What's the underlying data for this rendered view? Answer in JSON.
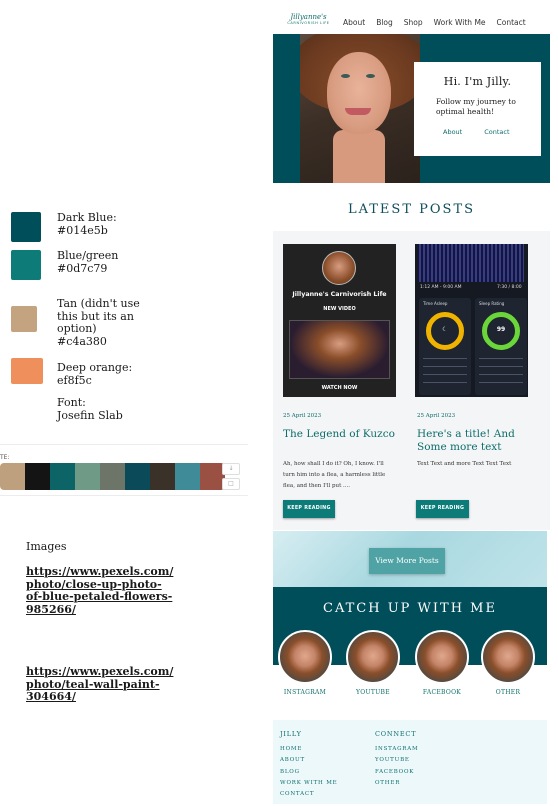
{
  "notes": {
    "swatches": [
      {
        "label": "Dark Blue:",
        "value": "#014e5b",
        "color": "#014e5b"
      },
      {
        "label": "Blue/green",
        "value": "#0d7c79",
        "color": "#0d7c79"
      },
      {
        "label": "Tan (didn't use this but its an option)",
        "value": "#c4a380",
        "color": "#c4a380"
      },
      {
        "label": "Deep orange:",
        "value": "ef8f5c",
        "color": "#ef8f5c"
      }
    ],
    "font_label": "Font:",
    "font_value": "Josefin Slab",
    "palette_label": "TE:",
    "palette_colors": [
      "#bfa07e",
      "#141414",
      "#0d6467",
      "#6f9a86",
      "#6c7567",
      "#0b4a59",
      "#3a3228",
      "#3f8b97",
      "#9a5043"
    ],
    "images_title": "Images",
    "image_links": [
      "https://www.pexels.com/photo/close-up-photo-of-blue-petaled-flowers-985266/",
      "https://www.pexels.com/photo/teal-wall-paint-304664/"
    ]
  },
  "site": {
    "logo_script": "Jillyanne's",
    "logo_sub": "CARNIVORISH LIFE",
    "nav": [
      "About",
      "Blog",
      "Shop",
      "Work With Me",
      "Contact"
    ],
    "hero": {
      "title": "Hi. I'm Jilly.",
      "subtitle": "Follow my journey to optimal health!",
      "links": [
        "About",
        "Contact"
      ]
    },
    "latest_heading": "LATEST POSTS",
    "posts": [
      {
        "date": "25 April 2023",
        "title": "The Legend of Kuzco",
        "excerpt": "Ah, how shall I do it? Oh, I know. I'll turn him into a flea, a harmless little flea, and then I'll put ....",
        "button": "KEEP READING",
        "thumb_title": "Jillyanne's Carnivorish Life",
        "thumb_new": "NEW VIDEO",
        "thumb_watch": "WATCH NOW"
      },
      {
        "date": "25 April 2023",
        "title": "Here's a title! And Some more text",
        "excerpt": "Text Text and more Text Text Text",
        "button": "KEEP READING",
        "thumb_time_left": "1:12 AM - 9:00 AM",
        "thumb_time_right": "7:30 / 8:00",
        "thumb_panel_left": "Time Asleep",
        "thumb_panel_right": "Sleep Rating",
        "thumb_score": "99"
      }
    ],
    "more_button": "View More Posts",
    "catch_heading": "CATCH UP WITH ME",
    "socials": [
      "INSTAGRAM",
      "YOUTUBE",
      "FACEBOOK",
      "OTHER"
    ],
    "footer": {
      "col1_head": "JILLY",
      "col1_items": [
        "HOME",
        "ABOUT",
        "BLOG",
        "WORK WITH ME",
        "CONTACT"
      ],
      "col2_head": "CONNECT",
      "col2_items": [
        "INSTAGRAM",
        "YOUTUBE",
        "FACEBOOK",
        "OTHER"
      ]
    }
  }
}
